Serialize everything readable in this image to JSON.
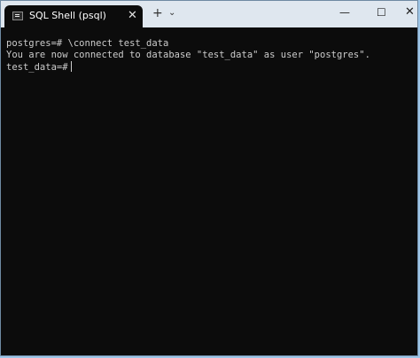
{
  "window": {
    "tab_title": "SQL Shell (psql)",
    "tab_icon": "terminal-icon",
    "controls": {
      "tab_close": "✕",
      "new_tab": "+",
      "tab_dropdown": "⌄",
      "minimize": "—",
      "maximize": "☐",
      "close": "✕"
    }
  },
  "terminal": {
    "lines": [
      "postgres=# \\connect test_data",
      "You are now connected to database \"test_data\" as user \"postgres\"."
    ],
    "prompt": "test_data=#"
  },
  "colors": {
    "terminal_background": "#0c0c0c",
    "terminal_text": "#cccccc",
    "titlebar_background": "#dfe7ef"
  }
}
